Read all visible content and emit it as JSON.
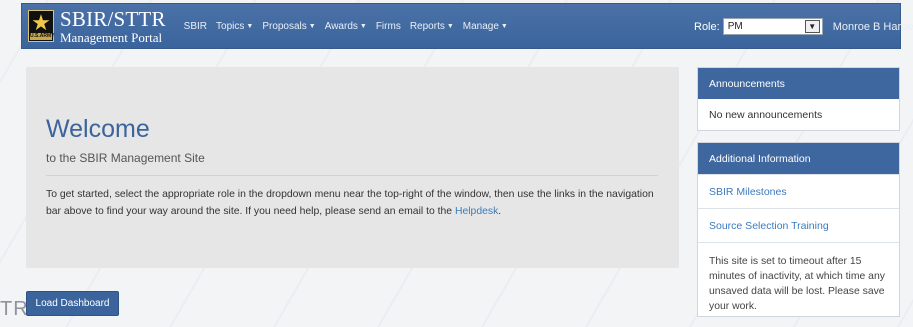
{
  "watermark": {
    "text": "TR"
  },
  "navbar": {
    "logo": {
      "badge_text": "U.S.ARMY",
      "icon": "star-icon"
    },
    "brand": {
      "title": "SBIR/STTR",
      "subtitle": "Management Portal"
    },
    "links": [
      {
        "label": "SBIR",
        "dropdown": false
      },
      {
        "label": "Topics",
        "dropdown": true
      },
      {
        "label": "Proposals",
        "dropdown": true
      },
      {
        "label": "Awards",
        "dropdown": true
      },
      {
        "label": "Firms",
        "dropdown": false
      },
      {
        "label": "Reports",
        "dropdown": true
      },
      {
        "label": "Manage",
        "dropdown": true
      }
    ],
    "role": {
      "label": "Role:",
      "selected": "PM"
    },
    "user": {
      "name": "Monroe B Harden"
    }
  },
  "welcome": {
    "title": "Welcome",
    "subtitle": "to the SBIR Management Site",
    "body_prefix": "To get started, select the appropriate role in the dropdown menu near the top-right of the window, then use the links in the navigation bar above to find your way around the site. If you need help, please send an email to the ",
    "helpdesk_link": "Helpdesk",
    "body_suffix": "."
  },
  "load_dashboard_button": "Load Dashboard",
  "announcements": {
    "title": "Announcements",
    "message": "No new announcements"
  },
  "additional_info": {
    "title": "Additional Information",
    "links": [
      "SBIR Milestones",
      "Source Selection Training"
    ],
    "note": "This site is set to timeout after 15 minutes of inactivity, at which time any unsaved data will be lost. Please save your work."
  },
  "colors": {
    "navbar": "#3b649c",
    "link": "#3b7bbf",
    "jumbotron": "#e6e6e6"
  }
}
